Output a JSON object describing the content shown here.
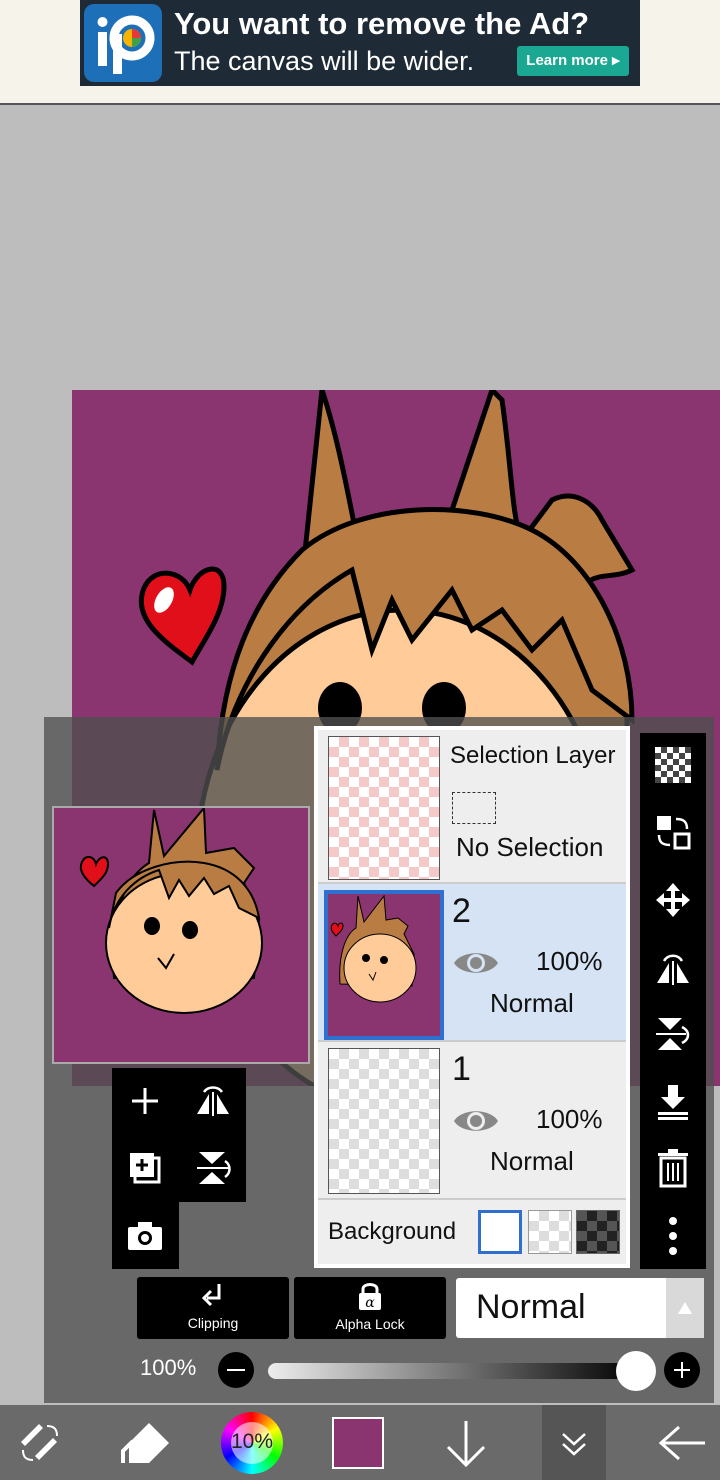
{
  "ad": {
    "title": "You want to remove the Ad?",
    "subtitle": "The canvas will be wider.",
    "button": "Learn more ▸",
    "logo_icon": "ibispaint-logo-icon"
  },
  "layers": [
    {
      "title": "Selection Layer",
      "status": "No Selection"
    },
    {
      "number": "2",
      "opacity": "100%",
      "blend": "Normal",
      "selected": true
    },
    {
      "number": "1",
      "opacity": "100%",
      "blend": "Normal",
      "selected": false
    }
  ],
  "background": {
    "label": "Background"
  },
  "buttons": {
    "clipping": "Clipping",
    "alpha_lock": "Alpha Lock"
  },
  "blend_mode": {
    "value": "Normal"
  },
  "opacity": {
    "value": "100%",
    "fraction": 1.0
  },
  "bottom_bar": {
    "brush_size": "10%"
  },
  "colors": {
    "canvas_bg": "#8b3570",
    "selected_row": "#d6e3f5",
    "accent": "#2f6fd0",
    "current_color": "#8b3570"
  }
}
